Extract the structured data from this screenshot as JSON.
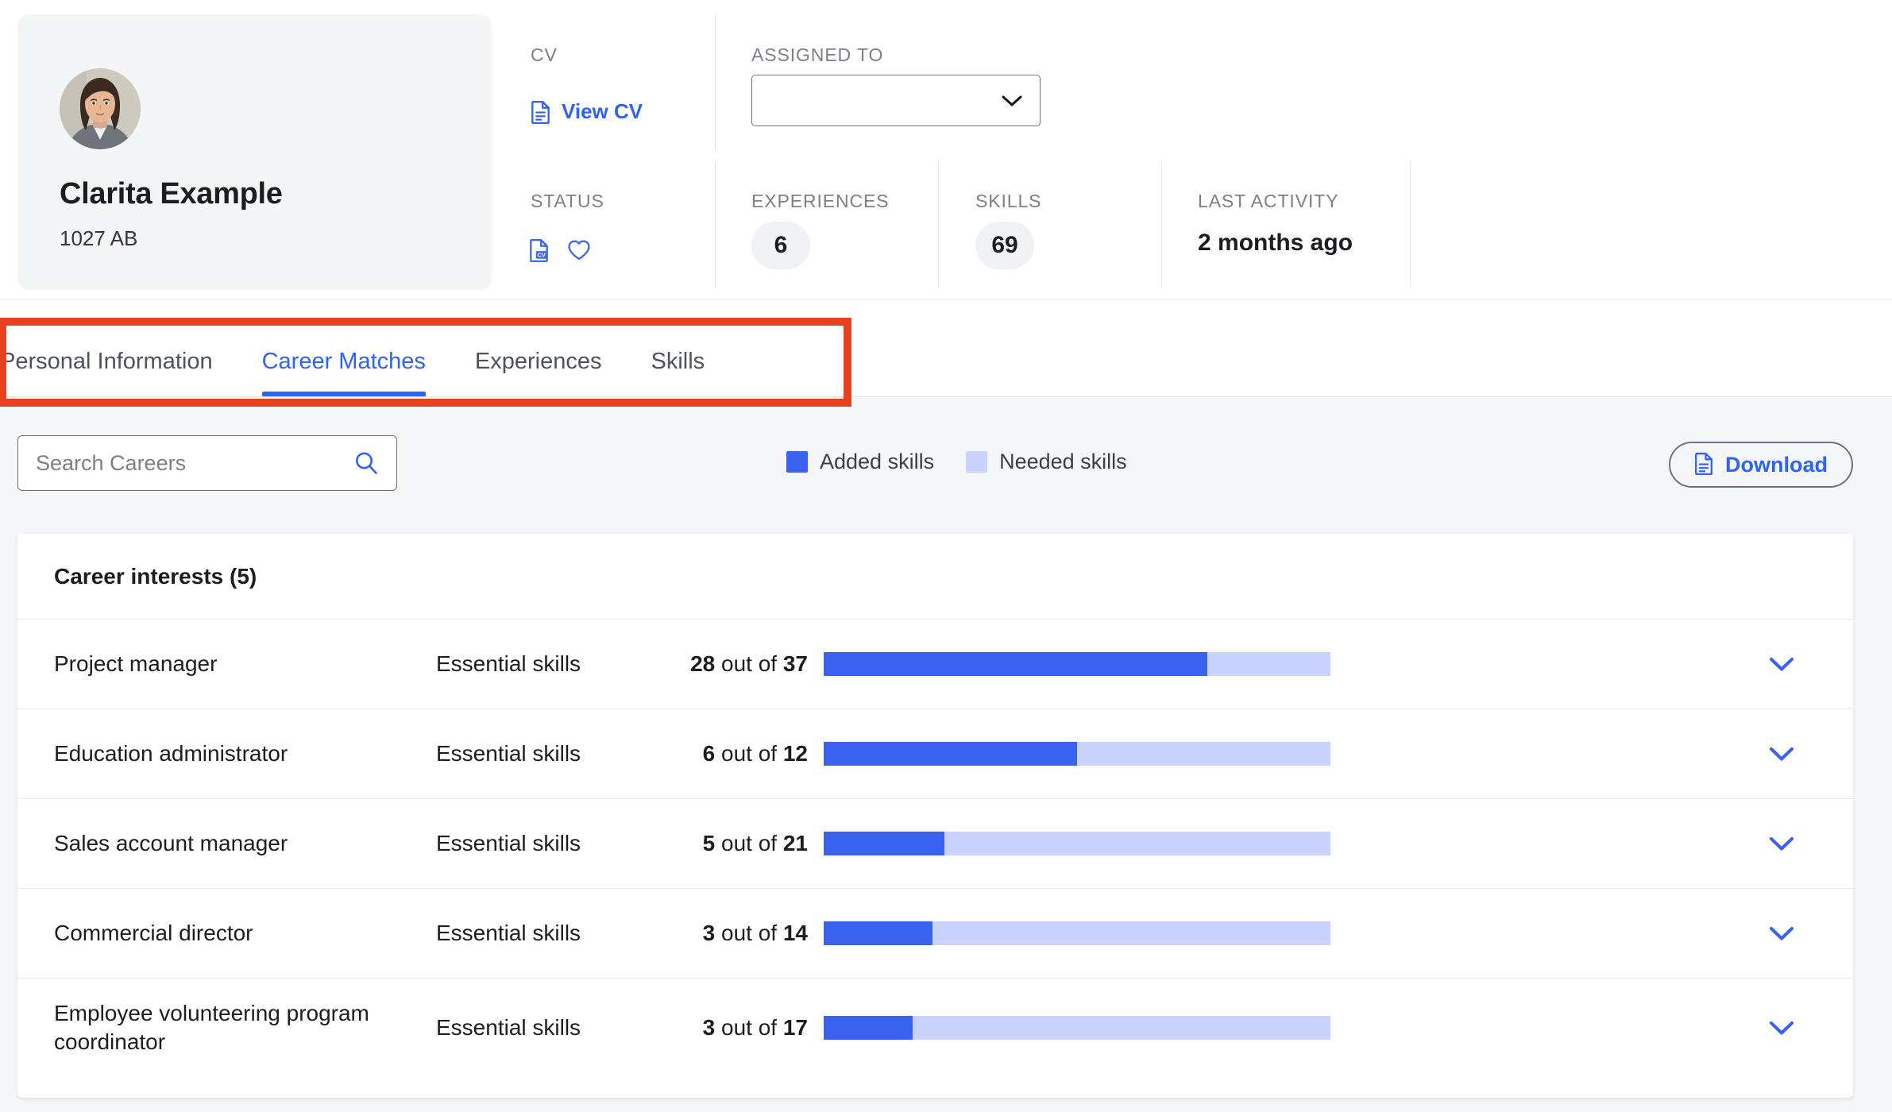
{
  "profile": {
    "name": "Clarita Example",
    "subtitle": "1027 AB",
    "avatar_icon": "user-avatar-photo"
  },
  "header": {
    "cv": {
      "label": "CV",
      "link_label": "View CV",
      "link_icon": "document-icon"
    },
    "assigned_to": {
      "label": "ASSIGNED TO",
      "value": "",
      "placeholder": "",
      "chevron_icon": "chevron-down-icon"
    },
    "status": {
      "label": "STATUS",
      "icons": [
        "cv-document-icon",
        "heart-icon"
      ]
    },
    "experiences": {
      "label": "EXPERIENCES",
      "value": "6"
    },
    "skills": {
      "label": "SKILLS",
      "value": "69"
    },
    "last_activity": {
      "label": "LAST ACTIVITY",
      "value": "2 months ago"
    }
  },
  "tabs": [
    {
      "label": "Personal Information",
      "active": false
    },
    {
      "label": "Career Matches",
      "active": true
    },
    {
      "label": "Experiences",
      "active": false
    },
    {
      "label": "Skills",
      "active": false
    }
  ],
  "toolbar": {
    "search": {
      "placeholder": "Search Careers",
      "value": "",
      "icon": "search-icon"
    },
    "legend": [
      {
        "label": "Added skills",
        "color": "#3b61ef"
      },
      {
        "label": "Needed skills",
        "color": "#c9d3fb"
      }
    ],
    "download": {
      "label": "Download",
      "icon": "document-download-icon"
    }
  },
  "career_list": {
    "header": "Career interests (5)",
    "rows": [
      {
        "title": "Project manager",
        "subtitle": "Essential skills",
        "added": "28",
        "total": "37",
        "out_of": "out of",
        "percent": 75.7,
        "chevron_icon": "chevron-down-icon"
      },
      {
        "title": "Education administrator",
        "subtitle": "Essential skills",
        "added": "6",
        "total": "12",
        "out_of": "out of",
        "percent": 50.0,
        "chevron_icon": "chevron-down-icon"
      },
      {
        "title": "Sales account manager",
        "subtitle": "Essential skills",
        "added": "5",
        "total": "21",
        "out_of": "out of",
        "percent": 23.8,
        "chevron_icon": "chevron-down-icon"
      },
      {
        "title": "Commercial director",
        "subtitle": "Essential skills",
        "added": "3",
        "total": "14",
        "out_of": "out of",
        "percent": 21.4,
        "chevron_icon": "chevron-down-icon"
      },
      {
        "title": "Employee volunteering program coordinator",
        "subtitle": "Essential skills",
        "added": "3",
        "total": "17",
        "out_of": "out of",
        "percent": 17.6,
        "chevron_icon": "chevron-down-icon"
      }
    ]
  },
  "annotation": {
    "highlight_color": "#e8411f"
  },
  "chart_data": {
    "type": "bar",
    "title": "Career interests (5)",
    "categories": [
      "Project manager",
      "Education administrator",
      "Sales account manager",
      "Commercial director",
      "Employee volunteering program coordinator"
    ],
    "series": [
      {
        "name": "Added skills",
        "values": [
          28,
          6,
          5,
          3,
          3
        ],
        "color": "#3b61ef"
      },
      {
        "name": "Needed skills",
        "values": [
          9,
          6,
          16,
          11,
          14
        ],
        "color": "#c9d3fb"
      }
    ],
    "totals": [
      37,
      12,
      21,
      14,
      17
    ],
    "xlabel": "",
    "ylabel": "",
    "legend_position": "top-center",
    "grid": false,
    "stacked": true
  }
}
